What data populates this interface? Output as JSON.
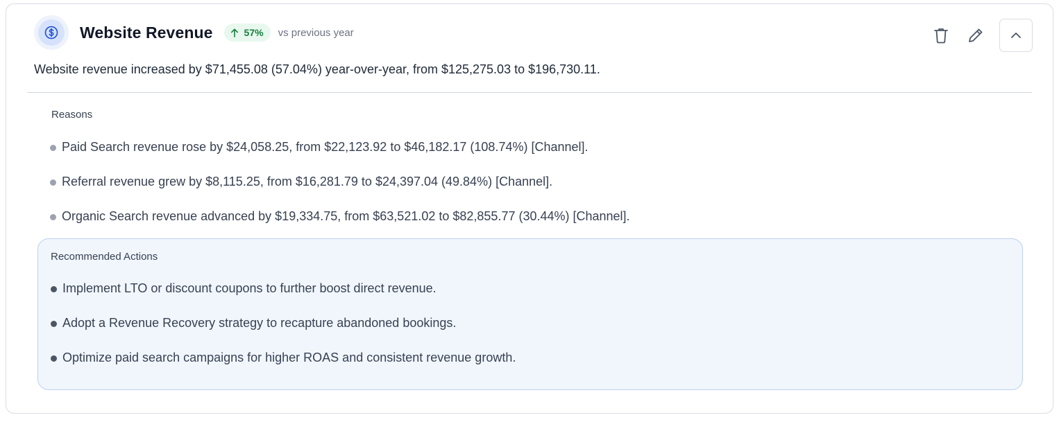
{
  "header": {
    "title": "Website Revenue",
    "badge_value": "57%",
    "badge_compare": "vs previous year",
    "icon": "dollar-circle-icon"
  },
  "summary": "Website revenue increased by $71,455.08 (57.04%) year-over-year, from $125,275.03 to $196,730.11.",
  "reasons": {
    "label": "Reasons",
    "items": [
      "Paid Search revenue rose by $24,058.25, from $22,123.92 to $46,182.17 (108.74%) [Channel].",
      "Referral revenue grew by $8,115.25, from $16,281.79 to $24,397.04 (49.84%) [Channel].",
      "Organic Search revenue advanced by $19,334.75, from $63,521.02 to $82,855.77 (30.44%) [Channel]."
    ]
  },
  "recommended_actions": {
    "label": "Recommended Actions",
    "items": [
      "Implement LTO or discount coupons to further boost direct revenue.",
      "Adopt a Revenue Recovery strategy to recapture abandoned bookings.",
      "Optimize paid search campaigns for higher ROAS and consistent revenue growth."
    ]
  },
  "actions": {
    "delete_icon": "trash-icon",
    "edit_icon": "pencil-icon",
    "collapse_icon": "chevron-up-icon"
  },
  "colors": {
    "accent_blue": "#1d4ed8",
    "badge_green": "#15803d",
    "badge_bg": "#e8f8ee",
    "rec_bg": "#f1f6fd",
    "rec_border": "#bcd0ef"
  }
}
